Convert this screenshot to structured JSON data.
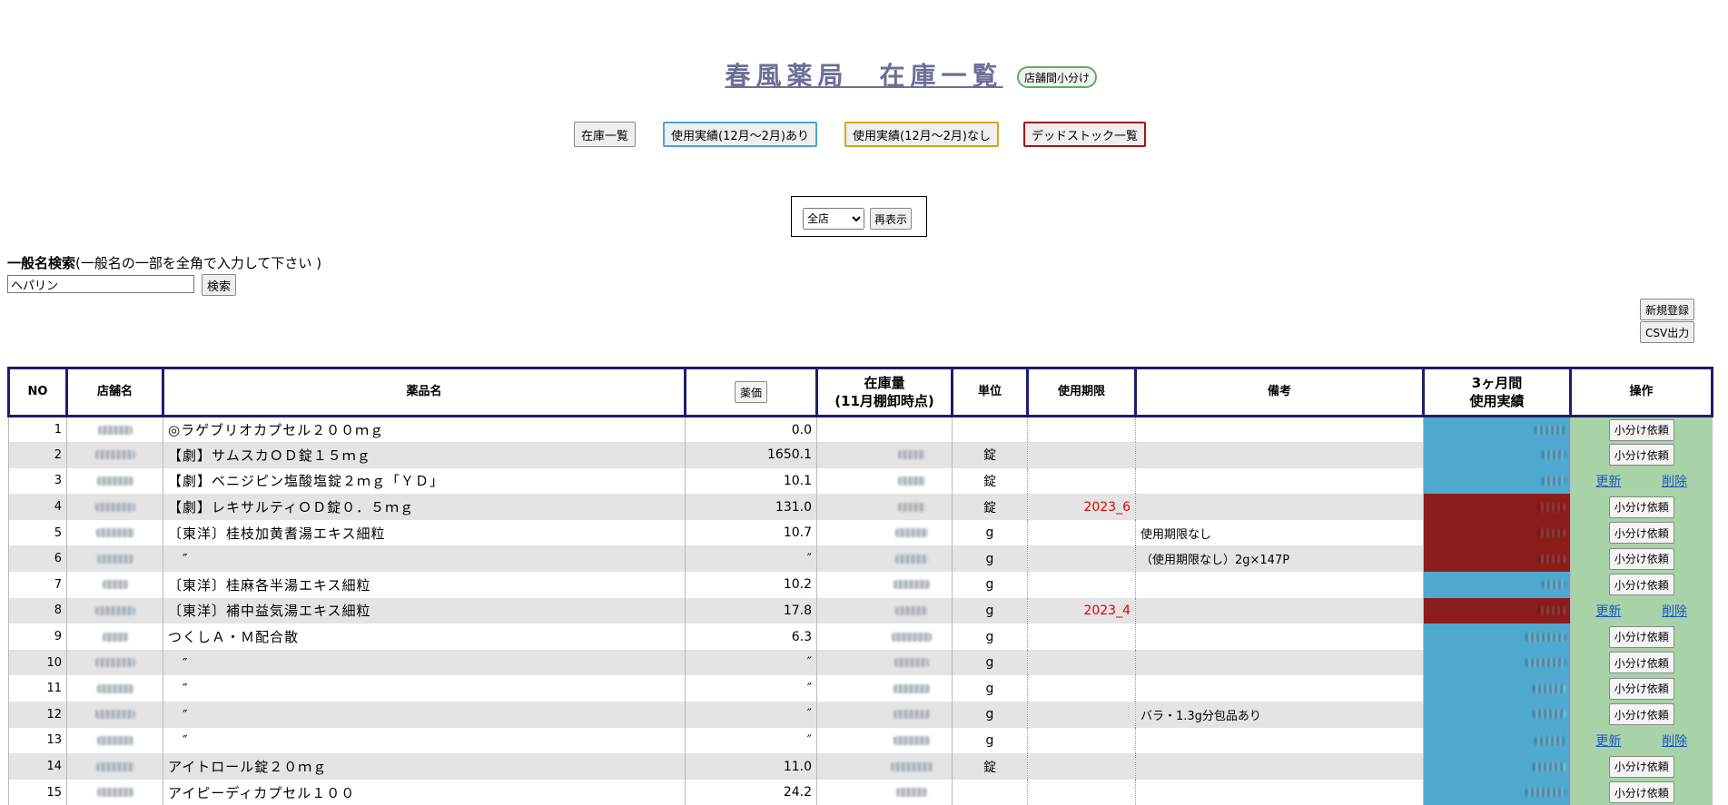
{
  "header": {
    "title": "春風薬局　在庫一覧",
    "shop_split_button": "店舗間小分け"
  },
  "nav": {
    "inventory_list": "在庫一覧",
    "with_usage": "使用実績(12月～2月)あり",
    "without_usage": "使用実績(12月～2月)なし",
    "dead_stock": "デッドストック一覧"
  },
  "store_filter": {
    "selected": "全店",
    "options": [
      "全店"
    ],
    "redisplay": "再表示"
  },
  "search": {
    "label_bold": "一般名検索",
    "label_hint": "(一般名の一部を全角で入力して下さい )",
    "value": "ヘパリン",
    "button": "検索"
  },
  "actions": {
    "new": "新規登録",
    "csv": "CSV出力"
  },
  "table": {
    "headers": {
      "no": "NO",
      "store": "店舗名",
      "drug": "薬品名",
      "price_button": "薬価",
      "qty_line1": "在庫量",
      "qty_line2": "(11月棚卸時点)",
      "unit": "単位",
      "expiry": "使用期限",
      "note": "備考",
      "usage_line1": "3ヶ月間",
      "usage_line2": "使用実績",
      "ops": "操作"
    },
    "op_labels": {
      "request": "小分け依頼",
      "update": "更新",
      "delete": "削除"
    },
    "rows": [
      {
        "no": "1",
        "drug": "◎ラゲブリオカプセル２００ｍｇ",
        "price": "0.0",
        "unit": "",
        "expiry": "",
        "note": "",
        "usage_color": "blue",
        "ops": "request"
      },
      {
        "no": "2",
        "drug": "【劇】サムスカＯＤ錠１５ｍｇ",
        "price": "1650.1",
        "unit": "錠",
        "expiry": "",
        "note": "",
        "usage_color": "blue",
        "ops": "request"
      },
      {
        "no": "3",
        "drug": "【劇】ベニジピン塩酸塩錠２ｍｇ「ＹＤ」",
        "price": "10.1",
        "unit": "錠",
        "expiry": "",
        "note": "",
        "usage_color": "blue",
        "ops": "edit"
      },
      {
        "no": "4",
        "drug": "【劇】レキサルティＯＤ錠０．５ｍｇ",
        "price": "131.0",
        "unit": "錠",
        "expiry": "2023_6",
        "note": "",
        "usage_color": "red",
        "ops": "request"
      },
      {
        "no": "5",
        "drug": "〔東洋〕桂枝加黄耆湯エキス細粒",
        "price": "10.7",
        "unit": "g",
        "expiry": "",
        "note": "使用期限なし",
        "usage_color": "red",
        "ops": "request"
      },
      {
        "no": "6",
        "drug": "　″",
        "price": "″",
        "unit": "g",
        "expiry": "",
        "note": "（使用期限なし）2g×147P",
        "usage_color": "red",
        "ops": "request"
      },
      {
        "no": "7",
        "drug": "〔東洋〕桂麻各半湯エキス細粒",
        "price": "10.2",
        "unit": "g",
        "expiry": "",
        "note": "",
        "usage_color": "blue",
        "ops": "request"
      },
      {
        "no": "8",
        "drug": "〔東洋〕補中益気湯エキス細粒",
        "price": "17.8",
        "unit": "g",
        "expiry": "2023_4",
        "note": "",
        "usage_color": "red",
        "ops": "edit"
      },
      {
        "no": "9",
        "drug": "つくしＡ・Ｍ配合散",
        "price": "6.3",
        "unit": "g",
        "expiry": "",
        "note": "",
        "usage_color": "blue",
        "ops": "request"
      },
      {
        "no": "10",
        "drug": "　″",
        "price": "″",
        "unit": "g",
        "expiry": "",
        "note": "",
        "usage_color": "blue",
        "ops": "request"
      },
      {
        "no": "11",
        "drug": "　″",
        "price": "″",
        "unit": "g",
        "expiry": "",
        "note": "",
        "usage_color": "blue",
        "ops": "request"
      },
      {
        "no": "12",
        "drug": "　″",
        "price": "″",
        "unit": "g",
        "expiry": "",
        "note": "バラ・1.3g分包品あり",
        "usage_color": "blue",
        "ops": "request"
      },
      {
        "no": "13",
        "drug": "　″",
        "price": "″",
        "unit": "g",
        "expiry": "",
        "note": "",
        "usage_color": "blue",
        "ops": "edit"
      },
      {
        "no": "14",
        "drug": "アイトロール錠２０ｍｇ",
        "price": "11.0",
        "unit": "錠",
        "expiry": "",
        "note": "",
        "usage_color": "blue",
        "ops": "request"
      },
      {
        "no": "15",
        "drug": "アイピーディカプセル１００",
        "price": "24.2",
        "unit": "",
        "expiry": "",
        "note": "",
        "usage_color": "blue",
        "ops": "request"
      }
    ]
  },
  "colors": {
    "usage_blue": "#4fa9cf",
    "usage_red": "#8b1c1c",
    "ops_green": "#a8d3a8",
    "header_border": "#1e1e6b",
    "expiry_red": "#e00000"
  }
}
